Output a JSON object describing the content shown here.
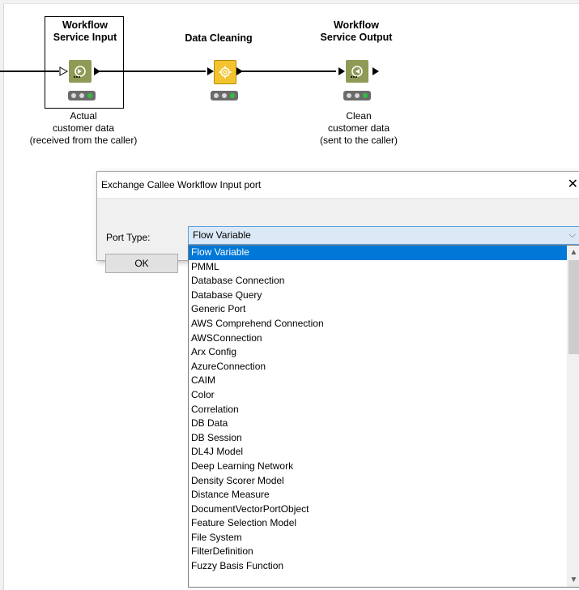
{
  "workflow": {
    "nodes": [
      {
        "title_line1": "Workflow",
        "title_line2": "Service Input",
        "desc_line1": "Actual",
        "desc_line2": "customer data",
        "desc_line3": "(received from the caller)"
      },
      {
        "title_line1": "Data Cleaning"
      },
      {
        "title_line1": "Workflow",
        "title_line2": "Service Output",
        "desc_line1": "Clean",
        "desc_line2": "customer data",
        "desc_line3": "(sent to the caller)"
      }
    ],
    "colors": {
      "io_node": "#8e9a55",
      "manipulator_node": "#f4c430",
      "status_green": "#2fbf3a",
      "status_gray": "#d8d8d8"
    }
  },
  "dialog": {
    "title": "Exchange Callee Workflow Input port",
    "close_glyph": "✕",
    "port_type_label": "Port Type:",
    "selected_value": "Flow Variable",
    "ok_label": "OK",
    "dropdown_arrow": "⌵"
  },
  "dropdown_items": [
    "Flow Variable",
    "PMML",
    "Database Connection",
    "Database Query",
    "Generic Port",
    "AWS Comprehend Connection",
    "AWSConnection",
    "Arx Config",
    "AzureConnection",
    "CAIM",
    "Color",
    "Correlation",
    "DB Data",
    "DB Session",
    "DL4J Model",
    "Deep Learning Network",
    "Density Scorer Model",
    "Distance Measure",
    "DocumentVectorPortObject",
    "Feature Selection Model",
    "File System",
    "FilterDefinition",
    "Fuzzy Basis Function"
  ],
  "scroll": {
    "up_glyph": "▲",
    "down_glyph": "▼"
  }
}
